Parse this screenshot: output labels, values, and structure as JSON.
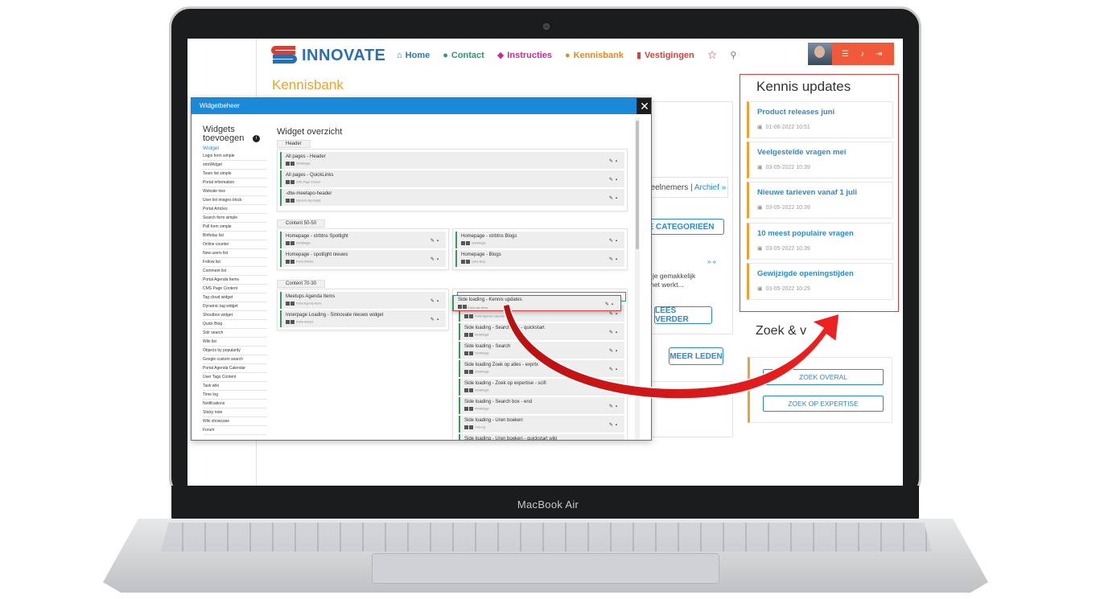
{
  "device": {
    "brand": "MacBook Air"
  },
  "header": {
    "logo_text": "INNOVATE",
    "nav": [
      {
        "label": "Home",
        "icon": "home-icon"
      },
      {
        "label": "Contact",
        "icon": "person-icon"
      },
      {
        "label": "Instructies",
        "icon": "graduation-cap-icon"
      },
      {
        "label": "Kennisbank",
        "icon": "lightbulb-icon"
      },
      {
        "label": "Vestigingen",
        "icon": "building-icon"
      }
    ],
    "star_glyph": "☆",
    "search_glyph": "⚲"
  },
  "page": {
    "title": "Kennisbank"
  },
  "background": {
    "deelnemers": "deelnemers | ",
    "archief": "Archief »",
    "categorieen_btn": "E CATEGORIEËN",
    "nav_arrows": "» «",
    "snippet1": "ar je gemakkelijk",
    "snippet2": "e het werkt...",
    "lees_verder": "LEES VERDER",
    "meer_leden": "MEER LEDEN"
  },
  "kennis_updates": {
    "title": "Kennis updates",
    "items": [
      {
        "title": "Product releases juni",
        "date": "01-06-2022 10:51"
      },
      {
        "title": "Veelgestelde vragen mei",
        "date": "03-05-2022 10:39"
      },
      {
        "title": "Nieuwe tarieven vanaf 1 juli",
        "date": "03-05-2022 10:39"
      },
      {
        "title": "10 meest populaire vragen",
        "date": "03-05-2022 10:39"
      },
      {
        "title": "Gewijzigde openingstijden",
        "date": "03-05-2022 10:29"
      }
    ]
  },
  "zoek": {
    "title": "Zoek & v",
    "overal": "ZOEK OVERAL",
    "expertise": "ZOEK OP EXPERTISE"
  },
  "modal": {
    "title": "Widgetbeheer",
    "close": "✕",
    "sidebar_title_1": "Widgets",
    "sidebar_title_2": "toevoegen",
    "sidebar_sub": "Widget",
    "sidebar_items": [
      "Login form simple",
      "xtrnWidget",
      "Team list simple",
      "Portal information",
      "Website tree",
      "User list images block",
      "Portal Articles",
      "Search form simple",
      "Poll form simple",
      "Birthday list",
      "Online counter",
      "New users list",
      "Follow list",
      "Comment list",
      "Portal Agenda Items",
      "CMS Page Content",
      "Tag cloud widget",
      "Dynamic tag widget",
      "Shoutbox widget",
      "Quick Blog",
      "Solr search",
      "Wiki list",
      "Objects by popularity",
      "Google custom search",
      "Portal Agenda Calendar",
      "User Tags Content",
      "Task wiki",
      "Time log",
      "Notifications",
      "Sticky note",
      "Wiki showcase",
      "Forum"
    ],
    "overview_title": "Widget overzicht",
    "sections": {
      "header": {
        "label": "Header",
        "widgets": [
          {
            "name": "All pages - Header",
            "sub": "htmlWidget"
          },
          {
            "name": "All pages - QuickLinks",
            "sub": "CMS Page Content"
          },
          {
            "name": "-dtw-meetapo-header",
            "sub": "Dynamic tag widget"
          }
        ]
      },
      "content5050": {
        "label": "Content 50-50",
        "left": [
          {
            "name": "Homepage - xtrbtns Spotlight",
            "sub": "htmlWidget"
          },
          {
            "name": "Homepage - spotlight nieuws",
            "sub": "Portal Articles"
          }
        ],
        "right": [
          {
            "name": "Homepage - xtrbtns Blogs",
            "sub": "htmlWidget"
          },
          {
            "name": "Homepage - Blogs",
            "sub": "Quick Blog"
          }
        ]
      },
      "content7030": {
        "label": "Content 70-30",
        "left": [
          {
            "name": "Meetups Agenda Items",
            "sub": "Portal Agenda Items"
          },
          {
            "name": "Innerpage Loading - Sinnovate nieuws widget",
            "sub": "Portal Articles"
          }
        ],
        "right": [
          {
            "name": "",
            "sub": "Portal Agenda Calendar"
          },
          {
            "name": "Side loading - Search box - quickstart",
            "sub": "htmlWidget"
          },
          {
            "name": "Side loading - Search",
            "sub": "htmlWidget"
          },
          {
            "name": "Side loading Zoek op alles - exprtx",
            "sub": "htmlWidget"
          },
          {
            "name": "Side loading - Zoek op expertise - scifi",
            "sub": "htmlWidget"
          },
          {
            "name": "Side loading - Search box - end",
            "sub": "htmlWidget"
          },
          {
            "name": "Side loading - Uren boeken",
            "sub": "Time log"
          },
          {
            "name": "Side loading - Uren boeken - quickstart wiki",
            "sub": ""
          }
        ]
      }
    },
    "dragging": {
      "name": "Side loading - Kennis updates",
      "sub": "Portal wiki items"
    }
  },
  "colors": {
    "accent_blue": "#1a8ad8",
    "accent_orange": "#f0a030",
    "highlight_red": "#e23b3b",
    "widget_green": "#3a9a5a"
  }
}
